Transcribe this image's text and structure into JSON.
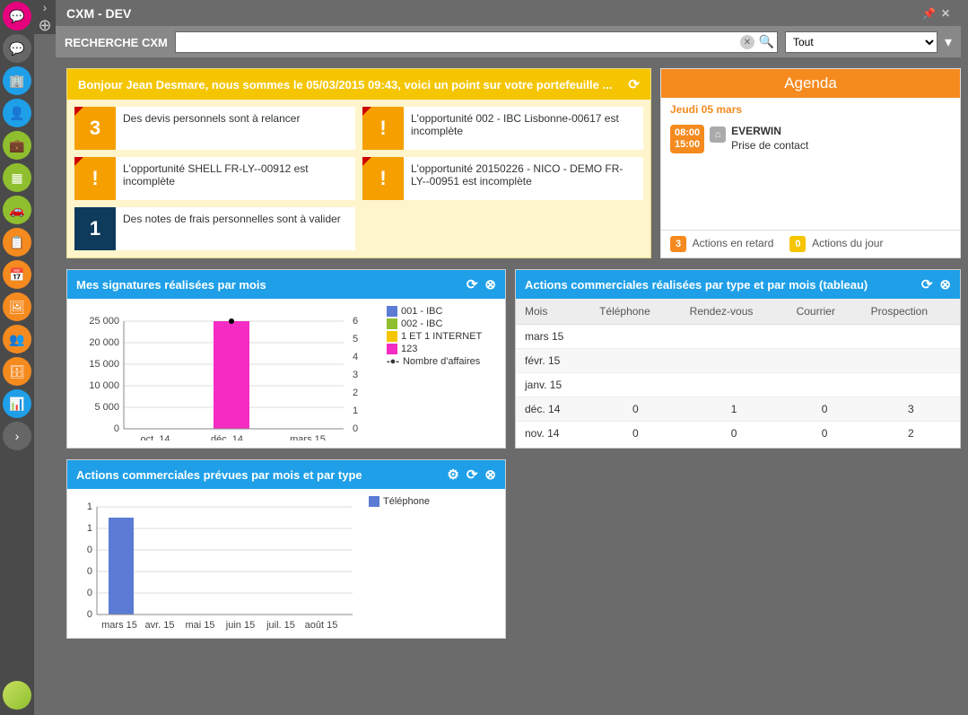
{
  "title": "CXM - DEV",
  "sidebar": [
    {
      "name": "chat",
      "color": "#e6007e",
      "icon": "💬"
    },
    {
      "name": "comment",
      "color": "#666",
      "icon": "💬"
    },
    {
      "name": "building",
      "color": "#1e9fe8",
      "icon": "🏢"
    },
    {
      "name": "user",
      "color": "#1e9fe8",
      "icon": "👤"
    },
    {
      "name": "briefcase",
      "color": "#8fbf2e",
      "icon": "💼"
    },
    {
      "name": "calculator",
      "color": "#8fbf2e",
      "icon": "▦"
    },
    {
      "name": "car",
      "color": "#8fbf2e",
      "icon": "🚗"
    },
    {
      "name": "calendar-check",
      "color": "#f58a1f",
      "icon": "📋"
    },
    {
      "name": "calendar",
      "color": "#f58a1f",
      "icon": "📅"
    },
    {
      "name": "image",
      "color": "#f58a1f",
      "icon": "🖼"
    },
    {
      "name": "users",
      "color": "#f58a1f",
      "icon": "👥"
    },
    {
      "name": "archive",
      "color": "#f58a1f",
      "icon": "🗄"
    },
    {
      "name": "chart",
      "color": "#1e9fe8",
      "icon": "📊"
    },
    {
      "name": "more",
      "color": "#666",
      "icon": "›"
    }
  ],
  "search": {
    "label": "RECHERCHE CXM",
    "placeholder": "",
    "value": "",
    "filter_value": "Tout"
  },
  "greeting": {
    "text": "Bonjour Jean Desmare, nous sommes le 05/03/2015 09:43, voici un point sur votre portefeuille ...",
    "tiles": [
      {
        "badge": "3",
        "badge_bg": "orange-b",
        "text": "Des devis personnels sont à relancer",
        "corner": true
      },
      {
        "badge": "!",
        "badge_bg": "orange-b",
        "text": "L'opportunité 002 - IBC Lisbonne-00617 est incomplète",
        "corner": true
      },
      {
        "badge": "!",
        "badge_bg": "orange-b",
        "text": "L'opportunité SHELL FR-LY--00912 est incomplète",
        "corner": true
      },
      {
        "badge": "!",
        "badge_bg": "orange-b",
        "text": "L'opportunité 20150226 - NICO - DEMO FR-LY--00951 est incomplète",
        "corner": true
      },
      {
        "badge": "1",
        "badge_bg": "navy-b",
        "text": "Des notes de frais personnelles sont à valider",
        "corner": false
      }
    ]
  },
  "agenda": {
    "title": "Agenda",
    "date": "Jeudi 05 mars",
    "items": [
      {
        "start": "08:00",
        "end": "15:00",
        "title": "EVERWIN",
        "subtitle": "Prise de contact"
      }
    ],
    "footer": {
      "late_count": "3",
      "late_label": "Actions en retard",
      "today_count": "0",
      "today_label": "Actions du jour"
    }
  },
  "chart1": {
    "title": "Mes signatures réalisées par mois",
    "legend": [
      "001 - IBC",
      "002 - IBC",
      "1 ET 1 INTERNET",
      "123",
      "Nombre d'affaires"
    ],
    "legend_colors": [
      "#5b7bd5",
      "#8fbf2e",
      "#f5c500",
      "#f52cc4",
      "#000"
    ]
  },
  "chart_data": [
    {
      "type": "bar",
      "title": "Mes signatures réalisées par mois",
      "categories": [
        "oct. 14",
        "déc. 14",
        "mars 15"
      ],
      "series": [
        {
          "name": "001 - IBC",
          "values": [
            0,
            0,
            0
          ]
        },
        {
          "name": "002 - IBC",
          "values": [
            0,
            0,
            0
          ]
        },
        {
          "name": "1 ET 1 INTERNET",
          "values": [
            0,
            0,
            0
          ]
        },
        {
          "name": "123",
          "values": [
            0,
            25000,
            0
          ]
        }
      ],
      "secondary_series": {
        "name": "Nombre d'affaires",
        "values": [
          null,
          6,
          null
        ]
      },
      "ylabel": "",
      "ylim": [
        0,
        25000
      ],
      "y2lim": [
        0,
        6
      ]
    },
    {
      "type": "table",
      "title": "Actions commerciales réalisées par type et par mois (tableau)",
      "columns": [
        "Mois",
        "Téléphone",
        "Rendez-vous",
        "Courrier",
        "Prospection"
      ],
      "rows": [
        [
          "mars 15",
          "",
          "",
          "",
          ""
        ],
        [
          "févr. 15",
          "",
          "",
          "",
          ""
        ],
        [
          "janv. 15",
          "",
          "",
          "",
          ""
        ],
        [
          "déc. 14",
          "0",
          "1",
          "0",
          "3"
        ],
        [
          "nov. 14",
          "0",
          "0",
          "0",
          "2"
        ]
      ]
    },
    {
      "type": "bar",
      "title": "Actions commerciales prévues par mois et par type",
      "categories": [
        "mars 15",
        "avr. 15",
        "mai 15",
        "juin 15",
        "juil. 15",
        "août 15"
      ],
      "series": [
        {
          "name": "Téléphone",
          "values": [
            0.9,
            0,
            0,
            0,
            0,
            0
          ]
        }
      ],
      "ylim": [
        0,
        1
      ]
    }
  ],
  "table_panel": {
    "title": "Actions commerciales réalisées par type et par mois (tableau)"
  },
  "chart3": {
    "title": "Actions commerciales prévues par mois et par type",
    "legend": [
      "Téléphone"
    ]
  }
}
